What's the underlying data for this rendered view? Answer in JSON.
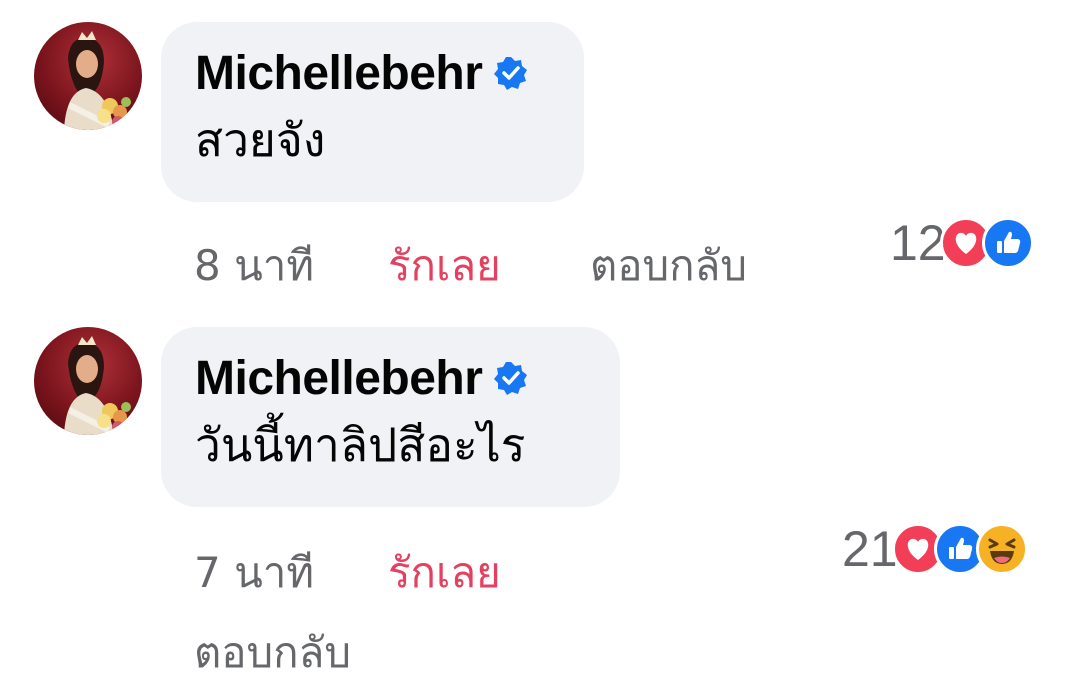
{
  "comments": [
    {
      "author": "Michellebehr",
      "verified": true,
      "text": "สวยจัง",
      "time": "8 นาที",
      "like_label": "รักเลย",
      "reply_label": "ตอบกลับ",
      "reaction_count": "12",
      "reactions": [
        "love-icon",
        "like-icon"
      ]
    },
    {
      "author": "Michellebehr",
      "verified": true,
      "text": "วันนี้ทาลิปสีอะไร",
      "time": "7 นาที",
      "like_label": "รักเลย",
      "reply_label": "ตอบกลับ",
      "reaction_count": "21",
      "reactions": [
        "love-icon",
        "like-icon",
        "haha-icon"
      ]
    }
  ],
  "colors": {
    "bubble_bg": "#f0f2f5",
    "love_action": "#e4405f",
    "meta_text": "#65676b",
    "verified_blue": "#1877f2"
  }
}
